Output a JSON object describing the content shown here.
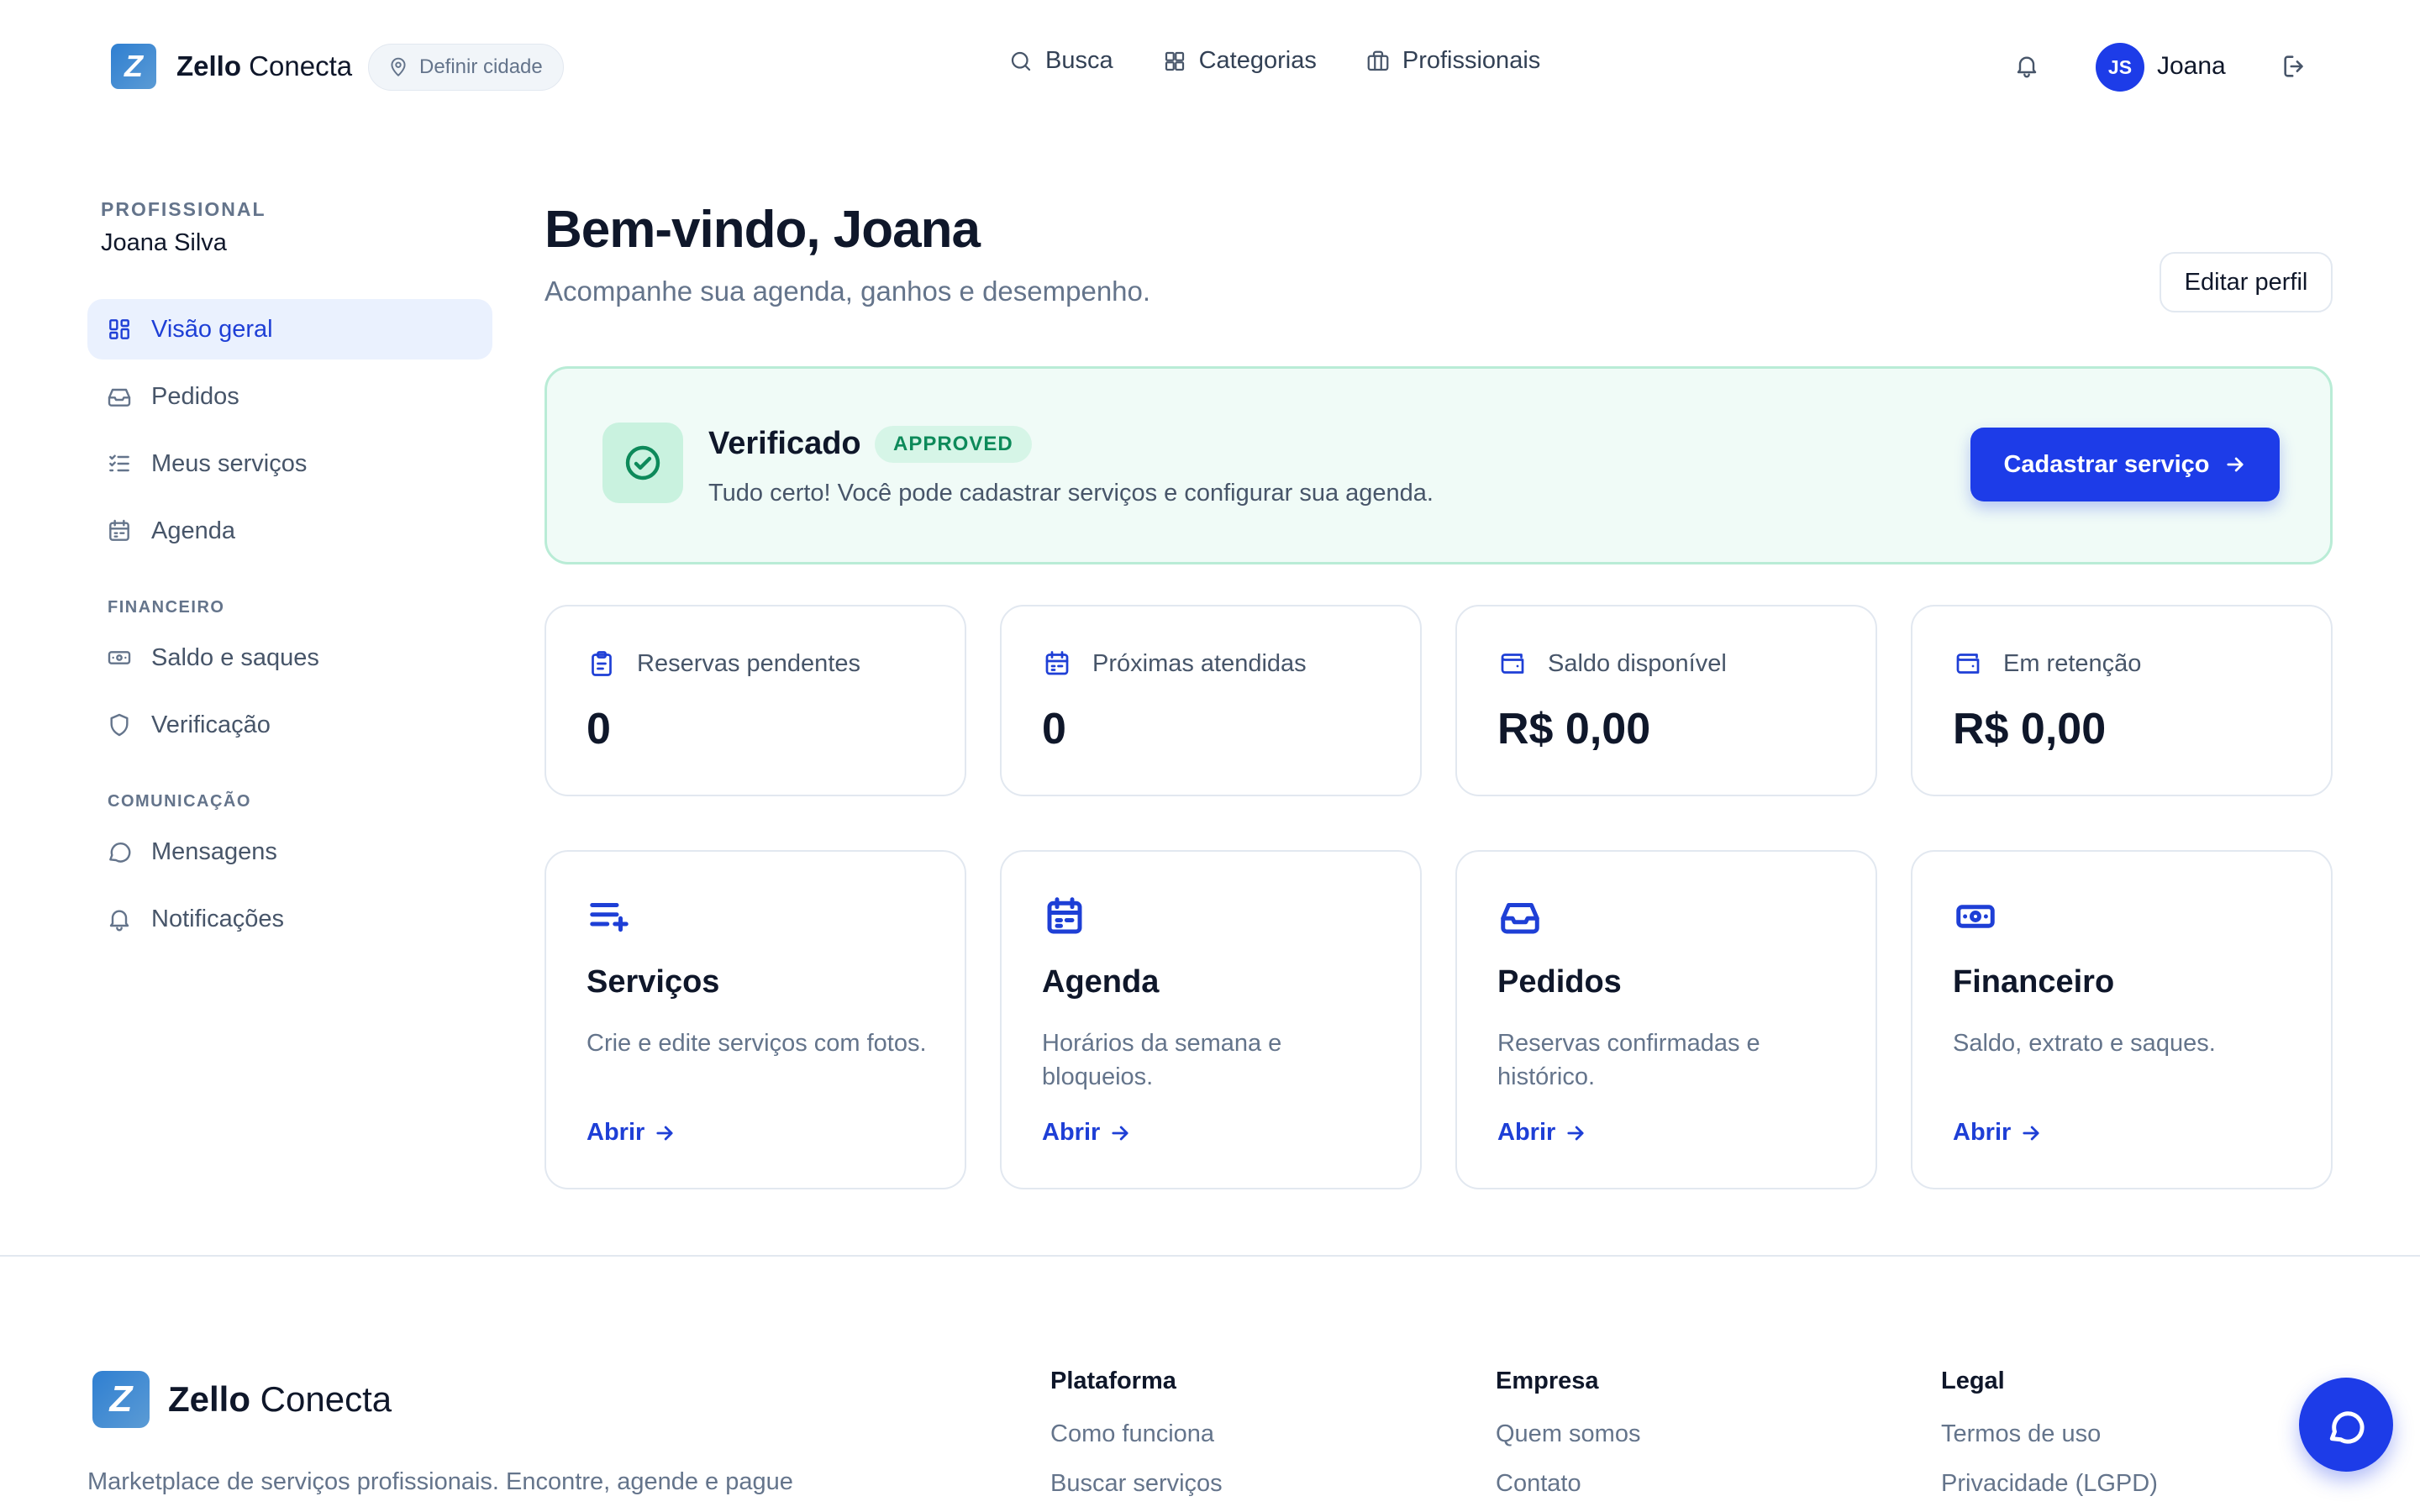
{
  "brand": {
    "name_bold": "Zello",
    "name_light": " Conecta",
    "mark": "Z"
  },
  "header": {
    "city_placeholder": "Definir cidade",
    "nav": [
      "Busca",
      "Categorias",
      "Profissionais"
    ],
    "avatar_initials": "JS",
    "user_name": "Joana"
  },
  "sidebar": {
    "role": "PROFISSIONAL",
    "name": "Joana Silva",
    "main_items": [
      "Visão geral",
      "Pedidos",
      "Meus serviços",
      "Agenda"
    ],
    "section_financeiro": "FINANCEIRO",
    "financeiro_items": [
      "Saldo e saques",
      "Verificação"
    ],
    "section_comunicacao": "COMUNICAÇÃO",
    "comunicacao_items": [
      "Mensagens",
      "Notificações"
    ]
  },
  "main": {
    "title": "Bem-vindo, Joana",
    "subtitle": "Acompanhe sua agenda, ganhos e desempenho.",
    "edit_profile": "Editar perfil"
  },
  "verification": {
    "title": "Verificado",
    "badge": "APPROVED",
    "text": "Tudo certo! Você pode cadastrar serviços e configurar sua agenda.",
    "cta": "Cadastrar serviço"
  },
  "stats": [
    {
      "label": "Reservas pendentes",
      "value": "0",
      "icon": "clipboard-icon"
    },
    {
      "label": "Próximas atendidas",
      "value": "0",
      "icon": "calendar-icon"
    },
    {
      "label": "Saldo disponível",
      "value": "R$ 0,00",
      "icon": "wallet-icon"
    },
    {
      "label": "Em retenção",
      "value": "R$ 0,00",
      "icon": "wallet-icon"
    }
  ],
  "features": [
    {
      "title": "Serviços",
      "desc": "Crie e edite serviços com fotos.",
      "link": "Abrir",
      "icon": "list-plus-icon"
    },
    {
      "title": "Agenda",
      "desc": "Horários da semana e bloqueios.",
      "link": "Abrir",
      "icon": "calendar-icon"
    },
    {
      "title": "Pedidos",
      "desc": "Reservas confirmadas e histórico.",
      "link": "Abrir",
      "icon": "inbox-icon"
    },
    {
      "title": "Financeiro",
      "desc": "Saldo, extrato e saques.",
      "link": "Abrir",
      "icon": "banknote-icon"
    }
  ],
  "footer": {
    "tagline": "Marketplace de serviços profissionais. Encontre, agende e pague",
    "columns": [
      {
        "title": "Plataforma",
        "links": [
          "Como funciona",
          "Buscar serviços"
        ]
      },
      {
        "title": "Empresa",
        "links": [
          "Quem somos",
          "Contato"
        ]
      },
      {
        "title": "Legal",
        "links": [
          "Termos de uso",
          "Privacidade (LGPD)"
        ]
      }
    ]
  },
  "colors": {
    "accent": "#1d3ce8",
    "success": "#0d8a5a",
    "success_bg": "#f0fbf7"
  }
}
